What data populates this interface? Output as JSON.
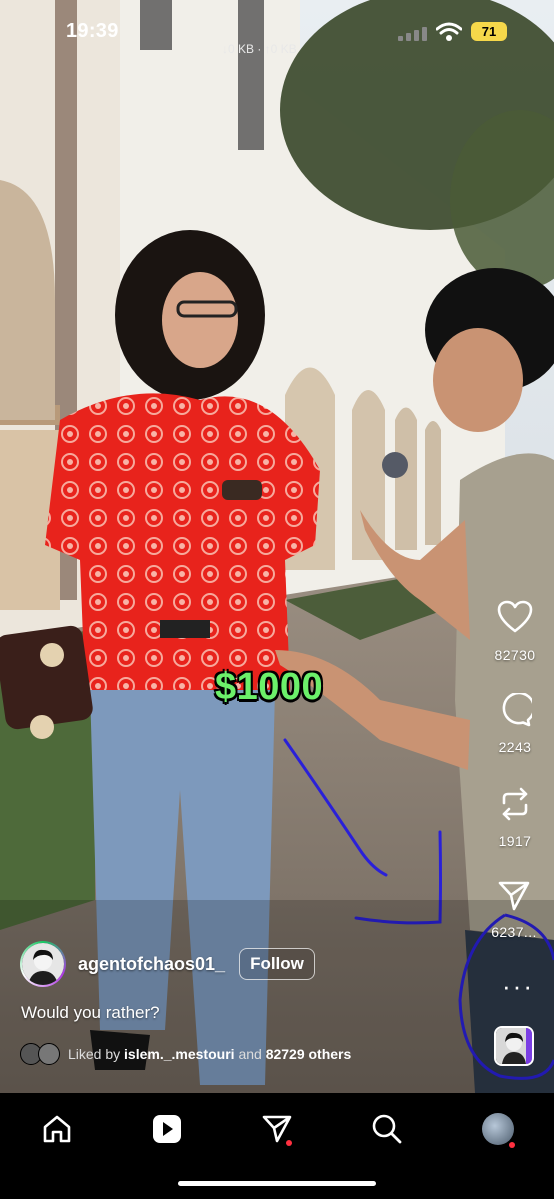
{
  "status_bar": {
    "time": "19:39",
    "network": "↓0 KB · ↑0 KB",
    "battery": "71",
    "battery_color": "#f6d84a"
  },
  "video": {
    "overlay_text": "$1000",
    "overlay_color": "#6cf06a"
  },
  "actions": {
    "likes": "82730",
    "comments": "2243",
    "reposts": "1917",
    "shares": "6237..."
  },
  "post": {
    "username": "agentofchaos01_",
    "follow_label": "Follow",
    "caption": "Would you rather?",
    "liked_by_prefix": "Liked by",
    "liked_by_user": "islem._.mestouri",
    "liked_by_and": "and",
    "liked_by_others": "82729 others"
  },
  "tabs": {
    "home": "home-icon",
    "reels": "reels-icon",
    "messages": "send-icon",
    "search": "search-icon",
    "profile": "profile-avatar"
  },
  "colors": {
    "notification_dot": "#ff3040",
    "annotation_ink": "#2a20d8"
  }
}
